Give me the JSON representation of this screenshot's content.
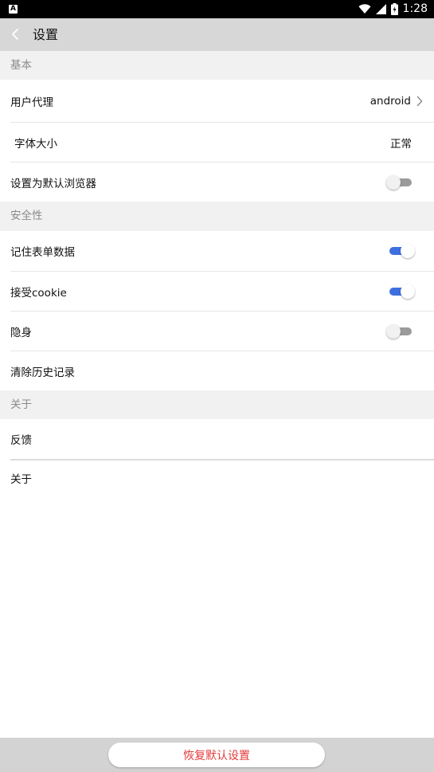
{
  "status_bar": {
    "left_icon_letter": "A",
    "time": "1:28",
    "icons": [
      "wifi-icon",
      "cell-signal-icon",
      "battery-icon"
    ]
  },
  "app_bar": {
    "title": "设置",
    "back_icon": "chevron-left-icon"
  },
  "sections": {
    "basic": {
      "header": "基本",
      "user_agent": {
        "label": "用户代理",
        "value": "android"
      },
      "font_size": {
        "label": "字体大小",
        "value": "正常"
      },
      "default_browser": {
        "label": "设置为默认浏览器",
        "enabled": false
      }
    },
    "security": {
      "header": "安全性",
      "remember_form": {
        "label": "记住表单数据",
        "enabled": true
      },
      "accept_cookie": {
        "label": "接受cookie",
        "enabled": true
      },
      "incognito": {
        "label": "隐身",
        "enabled": false
      },
      "clear_history": {
        "label": "清除历史记录"
      }
    },
    "about": {
      "header": "关于",
      "feedback": {
        "label": "反馈"
      },
      "about": {
        "label": "关于"
      }
    }
  },
  "reset_button": {
    "label": "恢复默认设置"
  },
  "colors": {
    "accent": "#3e6fe0",
    "reset_text": "#e23b3b",
    "section_bg": "#f1f1f1",
    "app_bar_bg": "#d7d7d7"
  }
}
